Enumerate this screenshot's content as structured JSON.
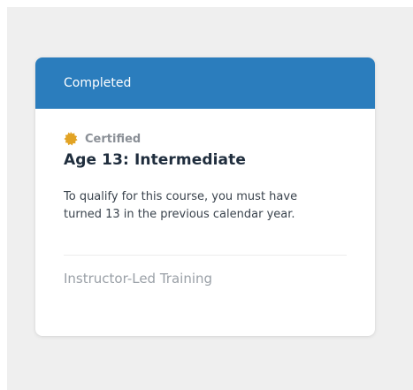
{
  "card": {
    "status_label": "Completed",
    "certification": {
      "icon": "certified-badge-icon",
      "label": "Certified",
      "icon_color": "#e2a324"
    },
    "title": "Age 13: Intermediate",
    "description": "To qualify for this course, you must have turned 13 in the previous calendar year.",
    "training_type": "Instructor-Led Training"
  },
  "colors": {
    "header_bg": "#2b7dbd",
    "page_bg": "#efefef",
    "card_bg": "#ffffff"
  }
}
